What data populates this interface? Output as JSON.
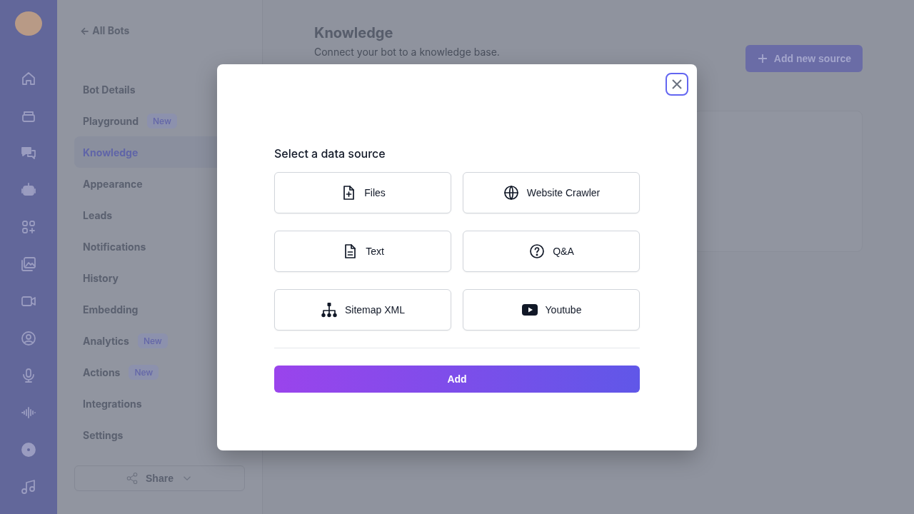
{
  "back_link": {
    "arrow": "←",
    "label": "All Bots"
  },
  "sidebar": {
    "items": [
      {
        "label": "Bot Details",
        "selected": false
      },
      {
        "label": "Playground",
        "selected": false,
        "badge": "New"
      },
      {
        "label": "Knowledge",
        "selected": true
      },
      {
        "label": "Appearance",
        "selected": false
      },
      {
        "label": "Leads",
        "selected": false
      },
      {
        "label": "Notifications",
        "selected": false
      },
      {
        "label": "History",
        "selected": false
      },
      {
        "label": "Embedding",
        "selected": false
      },
      {
        "label": "Analytics",
        "selected": false,
        "badge": "New"
      },
      {
        "label": "Actions",
        "selected": false,
        "badge": "New"
      },
      {
        "label": "Integrations",
        "selected": false
      },
      {
        "label": "Settings",
        "selected": false
      }
    ],
    "share_button": "Share"
  },
  "main": {
    "title": "Knowledge",
    "subtitle": "Connect your bot to a knowledge base.",
    "add_button": "Add new source"
  },
  "modal": {
    "title": "Select a data source",
    "sources": [
      {
        "label": "Files",
        "kind": "file"
      },
      {
        "label": "Website Crawler",
        "kind": "web"
      },
      {
        "label": "Text",
        "kind": "text"
      },
      {
        "label": "Q&A",
        "kind": "qa"
      },
      {
        "label": "Sitemap XML",
        "kind": "sitemap"
      },
      {
        "label": "Youtube",
        "kind": "youtube"
      }
    ],
    "submit": "Add"
  }
}
